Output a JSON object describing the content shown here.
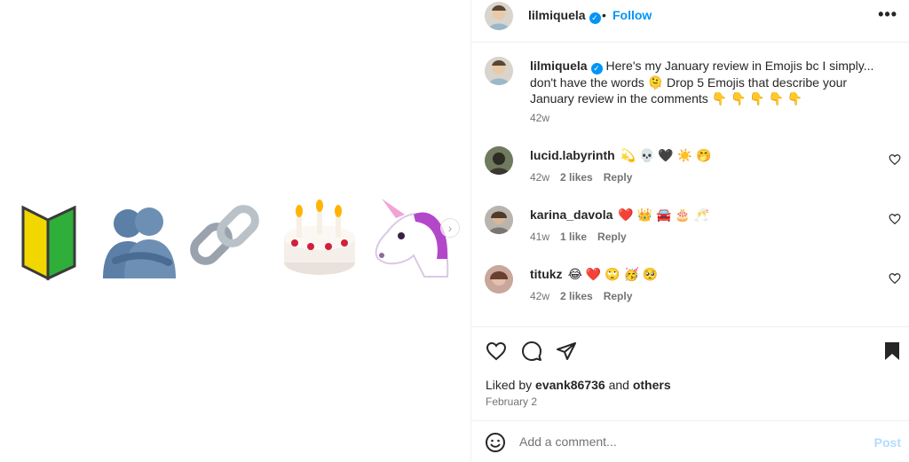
{
  "media": {
    "emojis": [
      "japanese-symbol-for-beginner",
      "people-hugging",
      "link",
      "birthday-cake",
      "unicorn"
    ],
    "next_glyph": "›"
  },
  "header": {
    "username": "lilmiquela",
    "verified_glyph": "✓",
    "separator": "•",
    "follow_label": "Follow",
    "more_glyph": "•••"
  },
  "caption": {
    "username": "lilmiquela",
    "text": "Here's my January review in Emojis bc I simply... don't have the words 🫠 Drop 5 Emojis that describe your January review in the comments 👇 👇 👇 👇 👇",
    "time": "42w"
  },
  "comments": [
    {
      "username": "lucid.labyrinth",
      "text": "💫 💀 🖤 ☀️ 🤭",
      "time": "42w",
      "likes": "2 likes",
      "reply": "Reply"
    },
    {
      "username": "karina_davola",
      "text": "❤️ 👑 🚘 🎂 🥂",
      "time": "41w",
      "likes": "1 like",
      "reply": "Reply"
    },
    {
      "username": "titukz",
      "text": "😂 ❤️ 🙄 🥳 🥺",
      "time": "42w",
      "likes": "2 likes",
      "reply": "Reply"
    }
  ],
  "actions": {
    "liked_prefix": "Liked by",
    "liked_user": "evank86736",
    "liked_and": "and",
    "liked_others": "others",
    "date": "February 2"
  },
  "add_comment": {
    "placeholder": "Add a comment...",
    "post_label": "Post"
  },
  "colors": {
    "accent": "#0095f6",
    "post_disabled": "#b3dbff",
    "muted": "#737373"
  }
}
